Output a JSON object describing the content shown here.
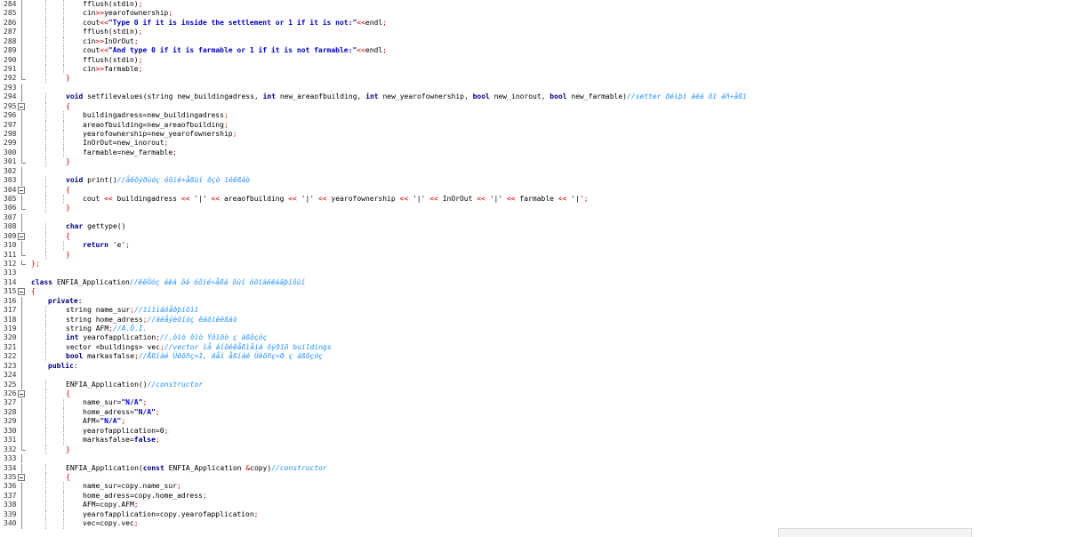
{
  "editor": {
    "lines": [
      {
        "n": "284",
        "indent": 3,
        "fold": "line",
        "tokens": [
          [
            "t",
            "fflush(stdin)"
          ],
          [
            "o",
            ";"
          ]
        ]
      },
      {
        "n": "285",
        "indent": 3,
        "fold": "line",
        "tokens": [
          [
            "t",
            "cin"
          ],
          [
            "o",
            ">>"
          ],
          [
            "t",
            "yearofownership"
          ],
          [
            "o",
            ";"
          ]
        ]
      },
      {
        "n": "286",
        "indent": 3,
        "fold": "line",
        "tokens": [
          [
            "t",
            "cout"
          ],
          [
            "o",
            "<<"
          ],
          [
            "s",
            "\"Type 0 if it is inside the settlement or 1 if it is not:\""
          ],
          [
            "o",
            "<<"
          ],
          [
            "t",
            "endl"
          ],
          [
            "o",
            ";"
          ]
        ]
      },
      {
        "n": "287",
        "indent": 3,
        "fold": "line",
        "tokens": [
          [
            "t",
            "fflush(stdin)"
          ],
          [
            "o",
            ";"
          ]
        ]
      },
      {
        "n": "288",
        "indent": 3,
        "fold": "line",
        "tokens": [
          [
            "t",
            "cin"
          ],
          [
            "o",
            ">>"
          ],
          [
            "t",
            "InOrOut"
          ],
          [
            "o",
            ";"
          ]
        ]
      },
      {
        "n": "289",
        "indent": 3,
        "fold": "line",
        "tokens": [
          [
            "t",
            "cout"
          ],
          [
            "o",
            "<<"
          ],
          [
            "s",
            "\"And type 0 if it is farmable or 1 if it is not farmable:\""
          ],
          [
            "o",
            "<<"
          ],
          [
            "t",
            "endl"
          ],
          [
            "o",
            ";"
          ]
        ]
      },
      {
        "n": "290",
        "indent": 3,
        "fold": "line",
        "tokens": [
          [
            "t",
            "fflush(stdin)"
          ],
          [
            "o",
            ";"
          ]
        ]
      },
      {
        "n": "291",
        "indent": 3,
        "fold": "line",
        "tokens": [
          [
            "t",
            "cin"
          ],
          [
            "o",
            ">>"
          ],
          [
            "t",
            "farmable"
          ],
          [
            "o",
            ";"
          ]
        ]
      },
      {
        "n": "292",
        "indent": 2,
        "fold": "end",
        "tokens": [
          [
            "b",
            "}"
          ]
        ]
      },
      {
        "n": "293",
        "indent": 0,
        "fold": "line",
        "tokens": []
      },
      {
        "n": "294",
        "indent": 2,
        "fold": "line",
        "tokens": [
          [
            "k",
            "void"
          ],
          [
            "t",
            " setfilevalues(string new_buildingadress, "
          ],
          [
            "k",
            "int"
          ],
          [
            "t",
            " new_areaofbuilding, "
          ],
          [
            "k",
            "int"
          ],
          [
            "t",
            " new_yearofownership, "
          ],
          [
            "k",
            "bool"
          ],
          [
            "t",
            " new_inorout, "
          ],
          [
            "k",
            "bool"
          ],
          [
            "t",
            " new_farmable)"
          ],
          [
            "c",
            "//setter ðéìþí äéá ôï áñ÷åßï"
          ]
        ]
      },
      {
        "n": "295",
        "indent": 2,
        "fold": "box",
        "tokens": [
          [
            "b",
            "{"
          ]
        ]
      },
      {
        "n": "296",
        "indent": 3,
        "fold": "line",
        "tokens": [
          [
            "t",
            "buildingadress=new_buildingadress"
          ],
          [
            "o",
            ";"
          ]
        ]
      },
      {
        "n": "297",
        "indent": 3,
        "fold": "line",
        "tokens": [
          [
            "t",
            "areaofbuilding=new_areaofbuilding"
          ],
          [
            "o",
            ";"
          ]
        ]
      },
      {
        "n": "298",
        "indent": 3,
        "fold": "line",
        "tokens": [
          [
            "t",
            "yearofownership=new_yearofownership"
          ],
          [
            "o",
            ";"
          ]
        ]
      },
      {
        "n": "299",
        "indent": 3,
        "fold": "line",
        "tokens": [
          [
            "t",
            "InOrOut=new_inorout"
          ],
          [
            "o",
            ";"
          ]
        ]
      },
      {
        "n": "300",
        "indent": 3,
        "fold": "line",
        "tokens": [
          [
            "t",
            "farmable=new_farmable"
          ],
          [
            "o",
            ";"
          ]
        ]
      },
      {
        "n": "301",
        "indent": 2,
        "fold": "end",
        "tokens": [
          [
            "b",
            "}"
          ]
        ]
      },
      {
        "n": "302",
        "indent": 0,
        "fold": "line",
        "tokens": []
      },
      {
        "n": "303",
        "indent": 2,
        "fold": "line",
        "tokens": [
          [
            "k",
            "void"
          ],
          [
            "t",
            " print()"
          ],
          [
            "c",
            "//åêôýðùóç óôïé÷åßùí ôçò ïéêßáò"
          ]
        ]
      },
      {
        "n": "304",
        "indent": 2,
        "fold": "box",
        "tokens": [
          [
            "b",
            "{"
          ]
        ]
      },
      {
        "n": "305",
        "indent": 3,
        "fold": "line",
        "tokens": [
          [
            "t",
            "cout "
          ],
          [
            "o",
            "<<"
          ],
          [
            "t",
            " buildingadress "
          ],
          [
            "o",
            "<<"
          ],
          [
            "t",
            " '|' "
          ],
          [
            "o",
            "<<"
          ],
          [
            "t",
            " areaofbuilding "
          ],
          [
            "o",
            "<<"
          ],
          [
            "t",
            " '|' "
          ],
          [
            "o",
            "<<"
          ],
          [
            "t",
            " yearofownership "
          ],
          [
            "o",
            "<<"
          ],
          [
            "t",
            " '|' "
          ],
          [
            "o",
            "<<"
          ],
          [
            "t",
            " InOrOut "
          ],
          [
            "o",
            "<<"
          ],
          [
            "t",
            " '|' "
          ],
          [
            "o",
            "<<"
          ],
          [
            "t",
            " farmable "
          ],
          [
            "o",
            "<<"
          ],
          [
            "t",
            " '|'"
          ],
          [
            "o",
            ";"
          ]
        ]
      },
      {
        "n": "306",
        "indent": 2,
        "fold": "end",
        "tokens": [
          [
            "b",
            "}"
          ]
        ]
      },
      {
        "n": "307",
        "indent": 0,
        "fold": "line",
        "tokens": []
      },
      {
        "n": "308",
        "indent": 2,
        "fold": "line",
        "tokens": [
          [
            "k",
            "char"
          ],
          [
            "t",
            " gettype()"
          ]
        ]
      },
      {
        "n": "309",
        "indent": 2,
        "fold": "box",
        "tokens": [
          [
            "b",
            "{"
          ]
        ]
      },
      {
        "n": "310",
        "indent": 3,
        "fold": "line",
        "tokens": [
          [
            "k",
            "return"
          ],
          [
            "t",
            " 'e'"
          ],
          [
            "o",
            ";"
          ]
        ]
      },
      {
        "n": "311",
        "indent": 2,
        "fold": "end",
        "tokens": [
          [
            "b",
            "}"
          ]
        ]
      },
      {
        "n": "312",
        "indent": 0,
        "fold": "end",
        "tokens": [
          [
            "b",
            "}"
          ],
          [
            "o",
            ";"
          ]
        ]
      },
      {
        "n": "313",
        "indent": 0,
        "fold": "none",
        "tokens": []
      },
      {
        "n": "314",
        "indent": 0,
        "fold": "none",
        "tokens": [
          [
            "k",
            "class"
          ],
          [
            "t",
            " ENFIA_Application"
          ],
          [
            "c",
            "//êëÜóç áéá ôá óôïé÷åßá ôùí óõíáëëáãþíôùí"
          ]
        ]
      },
      {
        "n": "315",
        "indent": 0,
        "fold": "box",
        "tokens": [
          [
            "b",
            "{"
          ]
        ]
      },
      {
        "n": "316",
        "indent": 1,
        "fold": "line",
        "tokens": [
          [
            "k",
            "private"
          ],
          [
            "t",
            ":"
          ]
        ]
      },
      {
        "n": "317",
        "indent": 2,
        "fold": "line",
        "tokens": [
          [
            "t",
            "string name_sur"
          ],
          [
            "o",
            ";"
          ],
          [
            "c",
            "//ïíïìáôåðþíõìï"
          ]
        ]
      },
      {
        "n": "318",
        "indent": 2,
        "fold": "line",
        "tokens": [
          [
            "t",
            "string home_adress"
          ],
          [
            "o",
            ";"
          ],
          [
            "c",
            "//äéåýèõíóç êáôïéêßáò"
          ]
        ]
      },
      {
        "n": "319",
        "indent": 2,
        "fold": "line",
        "tokens": [
          [
            "t",
            "string AFM"
          ],
          [
            "o",
            ";"
          ],
          [
            "c",
            "//Á.Ö.Ì."
          ]
        ]
      },
      {
        "n": "320",
        "indent": 2,
        "fold": "line",
        "tokens": [
          [
            "k",
            "int"
          ],
          [
            "t",
            " yearofapplication"
          ],
          [
            "o",
            ";"
          ],
          [
            "c",
            "//,ôïò ôïò Ýôïõò ç áßôçóç"
          ]
        ]
      },
      {
        "n": "321",
        "indent": 2,
        "fold": "line",
        "tokens": [
          [
            "t",
            "vector <buildings> vec"
          ],
          [
            "o",
            ";"
          ],
          [
            "c",
            "//vector ìå áíôéêåßìåíá ôýðïõ buildings"
          ]
        ]
      },
      {
        "n": "322",
        "indent": 2,
        "fold": "line",
        "tokens": [
          [
            "k",
            "bool"
          ],
          [
            "t",
            " markasfalse"
          ],
          [
            "o",
            ";"
          ],
          [
            "c",
            "//Åßíáé Üêõñç=1, äåí åßíáé Üêõñç=0 ç áßôçóç"
          ]
        ]
      },
      {
        "n": "323",
        "indent": 1,
        "fold": "line",
        "tokens": [
          [
            "k",
            "public"
          ],
          [
            "t",
            ":"
          ]
        ]
      },
      {
        "n": "324",
        "indent": 0,
        "fold": "line",
        "tokens": []
      },
      {
        "n": "325",
        "indent": 2,
        "fold": "line",
        "tokens": [
          [
            "t",
            "ENFIA_Application()"
          ],
          [
            "c",
            "//constructor"
          ]
        ]
      },
      {
        "n": "326",
        "indent": 2,
        "fold": "box",
        "tokens": [
          [
            "b",
            "{"
          ]
        ]
      },
      {
        "n": "327",
        "indent": 3,
        "fold": "line",
        "tokens": [
          [
            "t",
            "name_sur="
          ],
          [
            "s",
            "\"N/A\""
          ],
          [
            "o",
            ";"
          ]
        ]
      },
      {
        "n": "328",
        "indent": 3,
        "fold": "line",
        "tokens": [
          [
            "t",
            "home_adress="
          ],
          [
            "s",
            "\"N/A\""
          ],
          [
            "o",
            ";"
          ]
        ]
      },
      {
        "n": "329",
        "indent": 3,
        "fold": "line",
        "tokens": [
          [
            "t",
            "AFM="
          ],
          [
            "s",
            "\"N/A\""
          ],
          [
            "o",
            ";"
          ]
        ]
      },
      {
        "n": "330",
        "indent": 3,
        "fold": "line",
        "tokens": [
          [
            "t",
            "yearofapplication=0"
          ],
          [
            "o",
            ";"
          ]
        ]
      },
      {
        "n": "331",
        "indent": 3,
        "fold": "line",
        "tokens": [
          [
            "t",
            "markasfalse="
          ],
          [
            "k",
            "false"
          ],
          [
            "o",
            ";"
          ]
        ]
      },
      {
        "n": "332",
        "indent": 2,
        "fold": "end",
        "tokens": [
          [
            "b",
            "}"
          ]
        ]
      },
      {
        "n": "333",
        "indent": 0,
        "fold": "line",
        "tokens": []
      },
      {
        "n": "334",
        "indent": 2,
        "fold": "line",
        "tokens": [
          [
            "t",
            "ENFIA_Application("
          ],
          [
            "k",
            "const"
          ],
          [
            "t",
            " ENFIA_Application "
          ],
          [
            "o",
            "&"
          ],
          [
            "t",
            "copy)"
          ],
          [
            "c",
            "//constructor"
          ]
        ]
      },
      {
        "n": "335",
        "indent": 2,
        "fold": "box",
        "tokens": [
          [
            "b",
            "{"
          ]
        ]
      },
      {
        "n": "336",
        "indent": 3,
        "fold": "line",
        "tokens": [
          [
            "t",
            "name_sur=copy.name_sur"
          ],
          [
            "o",
            ";"
          ]
        ]
      },
      {
        "n": "337",
        "indent": 3,
        "fold": "line",
        "tokens": [
          [
            "t",
            "home_adress=copy.home_adress"
          ],
          [
            "o",
            ";"
          ]
        ]
      },
      {
        "n": "338",
        "indent": 3,
        "fold": "line",
        "tokens": [
          [
            "t",
            "AFM=copy.AFM"
          ],
          [
            "o",
            ";"
          ]
        ]
      },
      {
        "n": "339",
        "indent": 3,
        "fold": "line",
        "tokens": [
          [
            "t",
            "yearofapplication=copy.yearofapplication"
          ],
          [
            "o",
            ";"
          ]
        ]
      },
      {
        "n": "340",
        "indent": 3,
        "fold": "line",
        "tokens": [
          [
            "t",
            "vec=copy.vec"
          ],
          [
            "o",
            ";"
          ]
        ]
      }
    ]
  },
  "colors": {
    "keyword": "#000080",
    "string": "#0000cc",
    "operator": "#d00000",
    "comment": "#1e90ff",
    "line_number": "#333333",
    "background": "#ffffff"
  }
}
